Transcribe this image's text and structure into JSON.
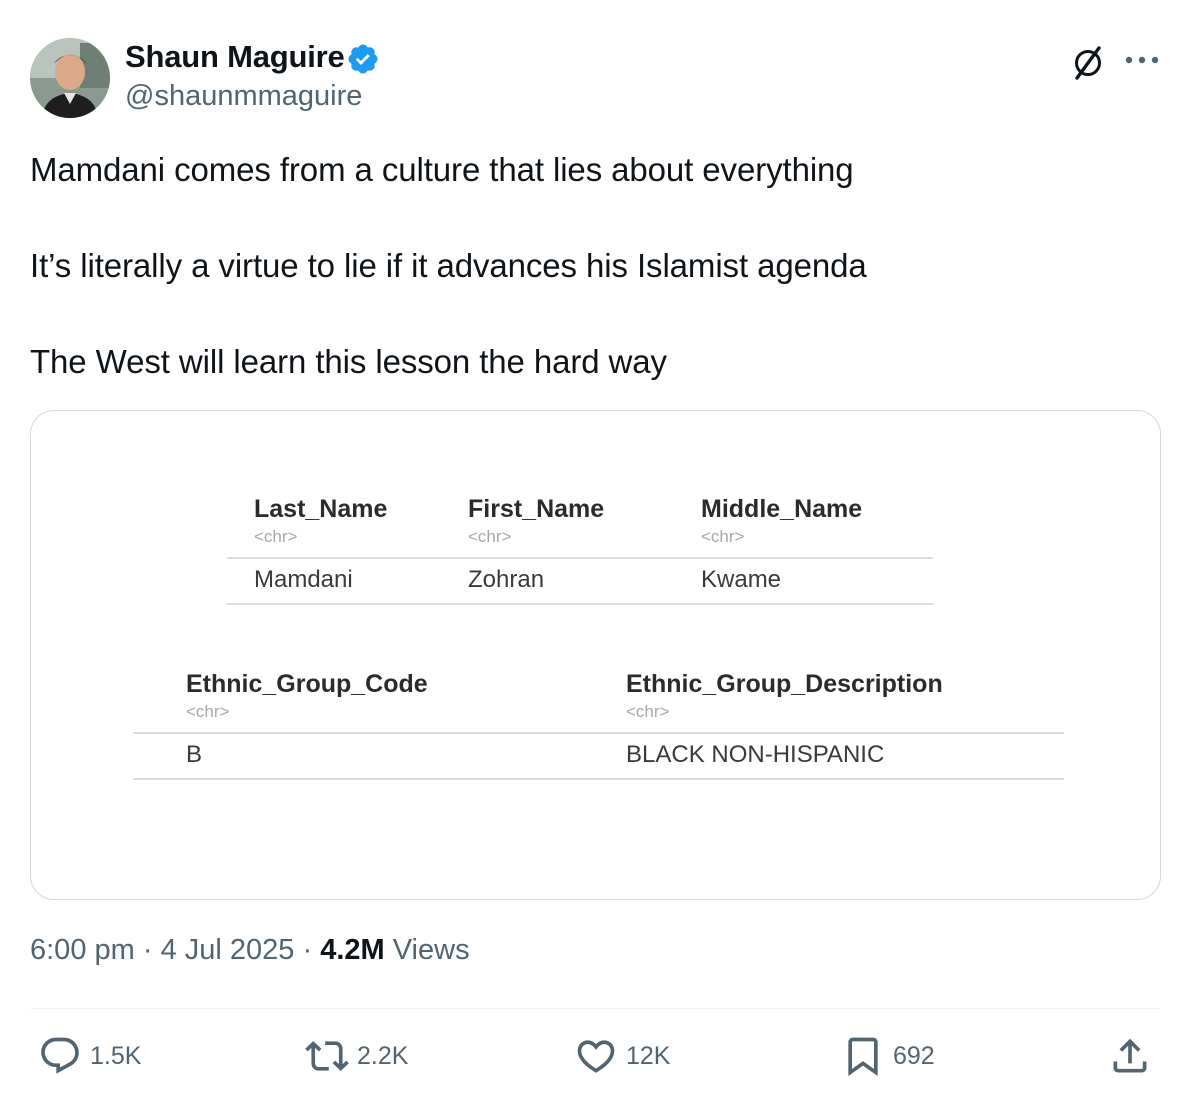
{
  "author": {
    "display_name": "Shaun Maguire",
    "handle": "@shaunmmaguire"
  },
  "tweet": {
    "lines": [
      "Mamdani comes from a culture that lies about everything",
      "It’s literally a virtue to lie if it advances his Islamist agenda",
      "The West will learn this lesson the hard way"
    ]
  },
  "media": {
    "table1": {
      "headers": [
        "Last_Name",
        "First_Name",
        "Middle_Name"
      ],
      "types": [
        "<chr>",
        "<chr>",
        "<chr>"
      ],
      "row": [
        "Mamdani",
        "Zohran",
        "Kwame"
      ]
    },
    "table2": {
      "headers": [
        "Ethnic_Group_Code",
        "Ethnic_Group_Description"
      ],
      "types": [
        "<chr>",
        "<chr>"
      ],
      "row": [
        "B",
        "BLACK NON-HISPANIC"
      ]
    }
  },
  "meta": {
    "time": "6:00 pm",
    "date": "4 Jul 2025",
    "views_count": "4.2M",
    "views_label": "Views"
  },
  "actions": {
    "replies": "1.5K",
    "reposts": "2.2K",
    "likes": "12K",
    "bookmarks": "692"
  },
  "colors": {
    "text": "#0f1419",
    "secondary": "#536471",
    "verified": "#1d9bf0",
    "border": "#cfd9de"
  },
  "icons": [
    "verified-badge-icon",
    "grok-icon",
    "more-icon",
    "reply-icon",
    "repost-icon",
    "like-icon",
    "bookmark-icon",
    "share-icon"
  ]
}
